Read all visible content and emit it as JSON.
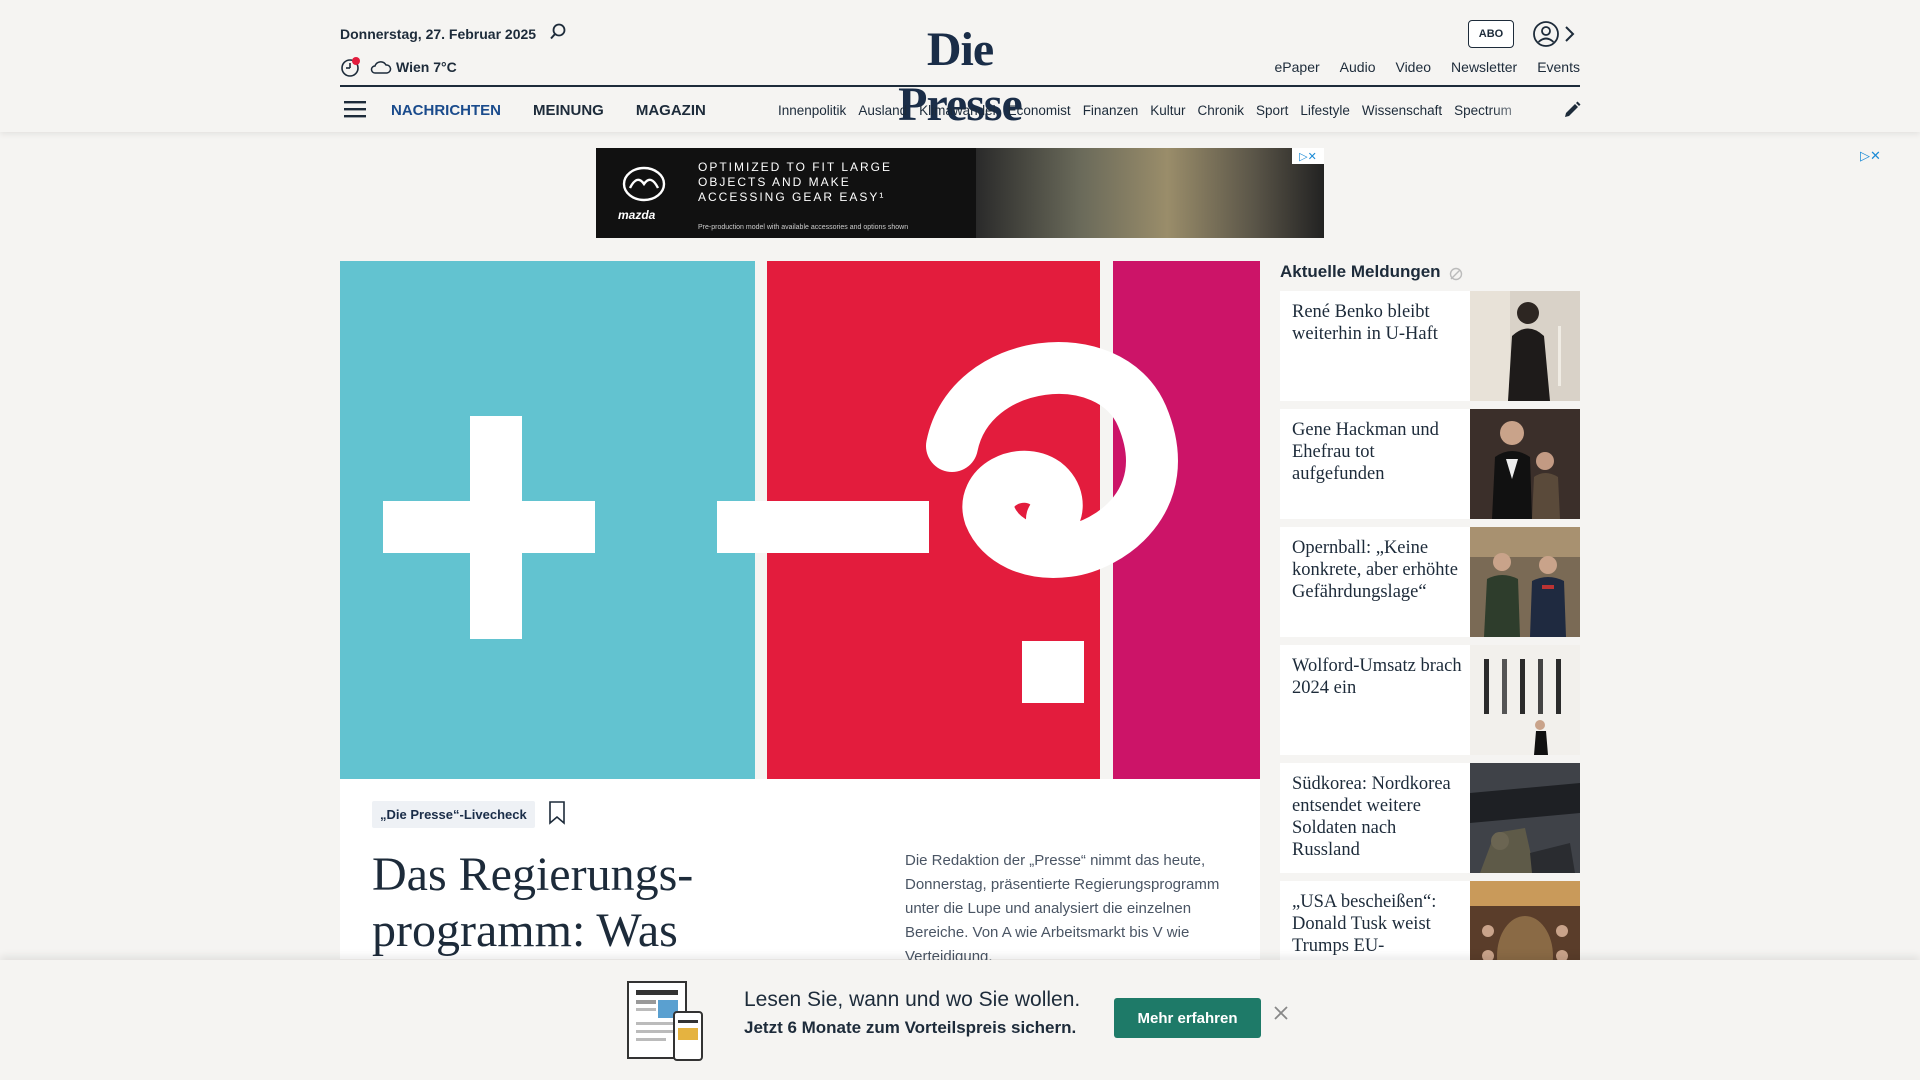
{
  "header": {
    "date": "Donnerstag, 27. Februar 2025",
    "weather": "Wien 7°C",
    "logo": "Die Presse",
    "abo_label": "ABO",
    "service_links": [
      "ePaper",
      "Audio",
      "Video",
      "Newsletter",
      "Events"
    ],
    "main_nav": [
      "NACHRICHTEN",
      "MEINUNG",
      "MAGAZIN"
    ],
    "sub_nav": [
      "Innenpolitik",
      "Ausland",
      "Klimawandel",
      "Economist",
      "Finanzen",
      "Kultur",
      "Chronik",
      "Sport",
      "Lifestyle",
      "Wissenschaft",
      "Spectrum"
    ],
    "accent_color": "#1a4b8c"
  },
  "ad": {
    "brand": "mazda",
    "text": "OPTIMIZED TO FIT LARGE OBJECTS AND MAKE ACCESSING GEAR EASY¹",
    "fine_print": "Pre-production model with available accessories and options shown",
    "choice_symbols": "▷✕"
  },
  "hero": {
    "colors": {
      "blue": "#62c3d0",
      "red": "#e31c3d",
      "magenta": "#cc1468"
    },
    "tag": "„Die Presse“-Livecheck",
    "headline": "Das Regierungs-programm: Was",
    "teaser": "Die Redaktion der „Presse“ nimmt das heute, Donnerstag, präsentierte Regierungsprogramm unter die Lupe und analysiert die einzelnen Bereiche. Von A wie Arbeitsmarkt bis V wie Verteidigung."
  },
  "sidebar": {
    "title": "Aktuelle Meldungen",
    "items": [
      {
        "text": "René Benko bleibt weiterhin in U-Haft"
      },
      {
        "text": "Gene Hackman und Ehefrau tot aufgefunden"
      },
      {
        "text": "Opernball: „Keine konkrete, aber erhöhte Gefährdungslage“"
      },
      {
        "text": "Wolford-Umsatz brach 2024 ein"
      },
      {
        "text": "Südkorea: Nordkorea entsendet weitere Soldaten nach Russland"
      },
      {
        "text": "„USA bescheißen“: Donald Tusk weist Trumps EU-"
      }
    ]
  },
  "promo": {
    "line1": "Lesen Sie, wann und wo Sie wollen.",
    "line2": "Jetzt 6 Monate zum Vorteilspreis sichern.",
    "button": "Mehr erfahren",
    "button_color": "#1e7a68"
  }
}
